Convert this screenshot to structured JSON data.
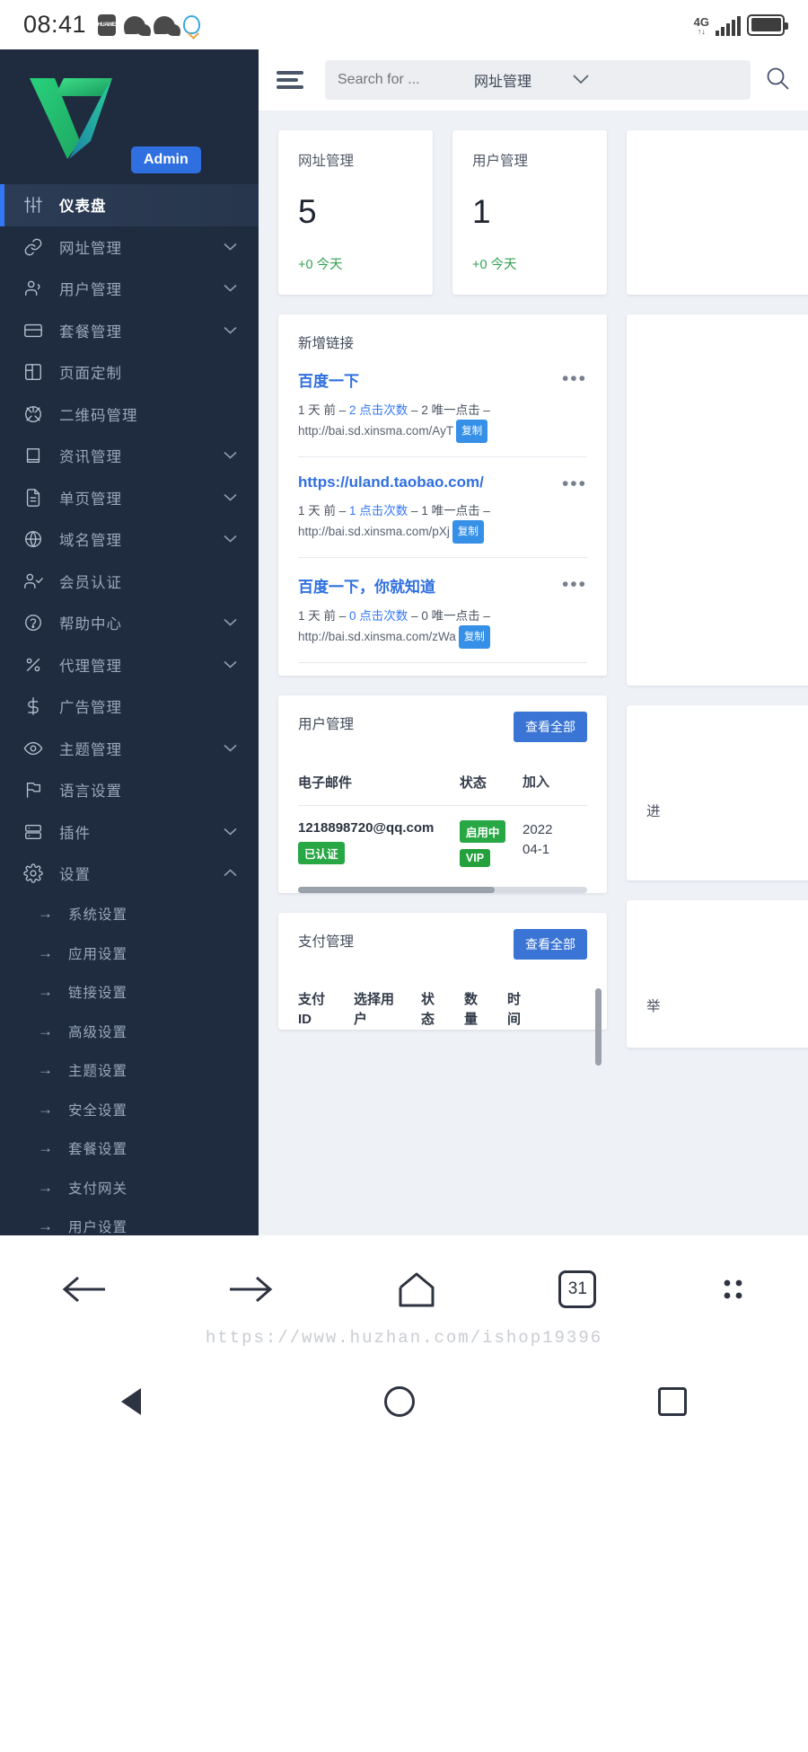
{
  "statusbar": {
    "time": "08:41",
    "huawei_label": "HUAWEI",
    "network": "4G",
    "network_sub": "↑↓"
  },
  "sidebar": {
    "brand": {
      "admin_badge": "Admin"
    },
    "items": [
      {
        "label": "仪表盘",
        "icon": "sliders-icon",
        "active": true,
        "chevron": false
      },
      {
        "label": "网址管理",
        "icon": "link-icon",
        "active": false,
        "chevron": true
      },
      {
        "label": "用户管理",
        "icon": "users-icon",
        "active": false,
        "chevron": true
      },
      {
        "label": "套餐管理",
        "icon": "credit-card-icon",
        "active": false,
        "chevron": true
      },
      {
        "label": "页面定制",
        "icon": "layout-icon",
        "active": false,
        "chevron": false
      },
      {
        "label": "二维码管理",
        "icon": "aperture-icon",
        "active": false,
        "chevron": false
      },
      {
        "label": "资讯管理",
        "icon": "book-icon",
        "active": false,
        "chevron": true
      },
      {
        "label": "单页管理",
        "icon": "file-text-icon",
        "active": false,
        "chevron": true
      },
      {
        "label": "域名管理",
        "icon": "globe-icon",
        "active": false,
        "chevron": true
      },
      {
        "label": "会员认证",
        "icon": "user-check-icon",
        "active": false,
        "chevron": false
      },
      {
        "label": "帮助中心",
        "icon": "help-circle-icon",
        "active": false,
        "chevron": true
      },
      {
        "label": "代理管理",
        "icon": "percent-icon",
        "active": false,
        "chevron": true
      },
      {
        "label": "广告管理",
        "icon": "dollar-icon",
        "active": false,
        "chevron": false
      },
      {
        "label": "主题管理",
        "icon": "eye-icon",
        "active": false,
        "chevron": true
      },
      {
        "label": "语言设置",
        "icon": "flag-icon",
        "active": false,
        "chevron": false
      },
      {
        "label": "插件",
        "icon": "server-icon",
        "active": false,
        "chevron": true
      },
      {
        "label": "设置",
        "icon": "gear-icon",
        "active": false,
        "chevron": true,
        "expanded": true
      }
    ],
    "sub_items": [
      {
        "label": "系统设置"
      },
      {
        "label": "应用设置"
      },
      {
        "label": "链接设置"
      },
      {
        "label": "高级设置"
      },
      {
        "label": "主题设置"
      },
      {
        "label": "安全设置"
      },
      {
        "label": "套餐设置"
      },
      {
        "label": "支付网关"
      },
      {
        "label": "用户设置"
      }
    ]
  },
  "topbar": {
    "search_placeholder": "Search for ...",
    "search_value": "",
    "select_value": "网址管理"
  },
  "stats": [
    {
      "title": "网址管理",
      "value": "5",
      "delta": "+0 今天"
    },
    {
      "title": "用户管理",
      "value": "1",
      "delta": "+0 今天"
    }
  ],
  "recent_links": {
    "title": "新增链接",
    "rows": [
      {
        "name": "百度一下",
        "age": "1 天 前",
        "clicks": "2 点击次数",
        "unique": "2 唯一点击",
        "url": "http://bai.sd.xinsma.com/AyT",
        "copy_label": "复制",
        "menu": "•••"
      },
      {
        "name": "https://uland.taobao.com/",
        "age": "1 天 前",
        "clicks": "1 点击次数",
        "unique": "1 唯一点击",
        "url": "http://bai.sd.xinsma.com/pXj",
        "copy_label": "复制",
        "menu": "•••"
      },
      {
        "name": "百度一下，你就知道",
        "age": "1 天 前",
        "clicks": "0 点击次数",
        "unique": "0 唯一点击",
        "url": "http://bai.sd.xinsma.com/zWa",
        "copy_label": "复制",
        "menu": "•••"
      }
    ]
  },
  "users_card": {
    "title": "用户管理",
    "view_all": "查看全部",
    "columns": [
      "电子邮件",
      "状态",
      "加入"
    ],
    "rows": [
      {
        "email": "1218898720@qq.com",
        "cert_badge": "已认证",
        "status_badge": "启用中",
        "vip_badge": "VIP",
        "joined_line1": "2022",
        "joined_line2": "04-1"
      }
    ]
  },
  "pay_card": {
    "title": "支付管理",
    "view_all": "查看全部",
    "columns": [
      "支付 ID",
      "选择用户",
      "状态",
      "数量",
      "时间"
    ],
    "columns_split": [
      [
        "支付",
        "ID"
      ],
      [
        "选择用",
        "户"
      ],
      [
        "状",
        "态"
      ],
      [
        "数",
        "量"
      ],
      [
        "时",
        "间"
      ]
    ]
  },
  "peek_cards": [
    {
      "label": "　"
    },
    {
      "label": "　"
    },
    {
      "label": "进"
    },
    {
      "label": "举"
    }
  ],
  "browser_bar": {
    "back": "back-arrow-icon",
    "forward": "forward-arrow-icon",
    "home": "home-icon",
    "tab_count": "31",
    "menu": "more-menu-icon"
  },
  "watermark": "https://www.huzhan.com/ishop19396",
  "android_nav": {
    "back": "triangle-back-icon",
    "home": "circle-home-icon",
    "recents": "square-recents-icon"
  },
  "colors": {
    "sidebar_bg": "#1f2b3e",
    "accent_blue": "#3478f6",
    "green": "#35a154",
    "link_blue": "#2f6fe0"
  }
}
